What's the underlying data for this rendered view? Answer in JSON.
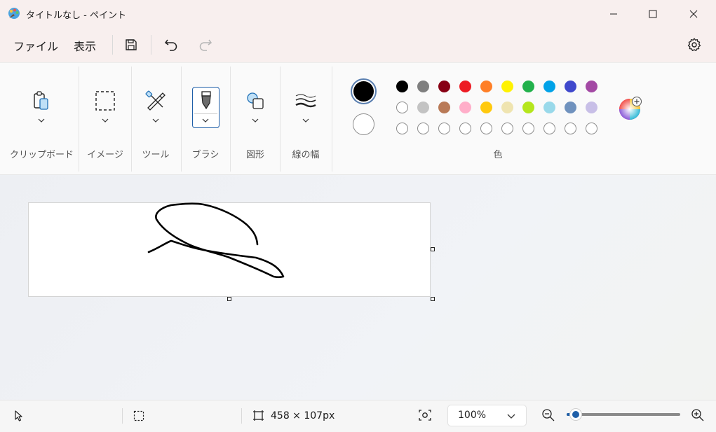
{
  "window": {
    "title": "タイトルなし - ペイント"
  },
  "menu": {
    "file": "ファイル",
    "view": "表示"
  },
  "ribbon": {
    "groups": [
      {
        "label": "クリップボード",
        "icon": "clipboard-icon"
      },
      {
        "label": "イメージ",
        "icon": "selection-icon"
      },
      {
        "label": "ツール",
        "icon": "tools-icon"
      },
      {
        "label": "ブラシ",
        "icon": "brush-icon"
      },
      {
        "label": "図形",
        "icon": "shapes-icon"
      },
      {
        "label": "線の幅",
        "icon": "line-width-icon"
      }
    ],
    "colors_label": "色",
    "primary_color": "#000000",
    "secondary_color": "#ffffff",
    "palette_row1": [
      "#000000",
      "#7f7f7f",
      "#880015",
      "#ed1c24",
      "#ff7f27",
      "#fff200",
      "#22b14c",
      "#00a2e8",
      "#3f48cc",
      "#a349a4"
    ],
    "palette_row2": [
      "#ffffff",
      "#c3c3c3",
      "#b97a57",
      "#ffaec9",
      "#ffc90e",
      "#efe4b0",
      "#b5e61d",
      "#99d9ea",
      "#7092be",
      "#c8bfe7"
    ]
  },
  "status": {
    "canvas_size": "458 × 107px",
    "zoom_value": "100%",
    "zoom_level": 0.08
  }
}
